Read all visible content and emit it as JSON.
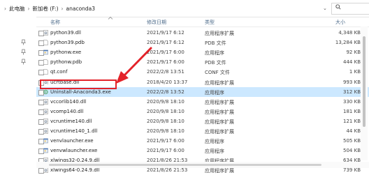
{
  "breadcrumb": {
    "items": [
      "此电脑",
      "新加卷 (F:)",
      "anaconda3"
    ],
    "separator": "›"
  },
  "columns": {
    "name": "名称",
    "modified": "修改日期",
    "type": "类型",
    "size": "大小"
  },
  "files": [
    {
      "name": "python39.dll",
      "modified": "2021/9/17 6:12",
      "type": "应用程序扩展",
      "size": "4,348 KB",
      "icon": "dll-icon"
    },
    {
      "name": "python39.pdb",
      "modified": "2021/9/17 6:12",
      "type": "PDB 文件",
      "size": "13,284 KB",
      "icon": "file-icon"
    },
    {
      "name": "pythonw.exe",
      "modified": "2021/9/17 6:00",
      "type": "应用程序",
      "size": "92 KB",
      "icon": "exe-icon"
    },
    {
      "name": "pythonw.pdb",
      "modified": "2021/9/17 6:00",
      "type": "PDB 文件",
      "size": "444 KB",
      "icon": "file-icon"
    },
    {
      "name": "qt.conf",
      "modified": "2022/2/8 13:51",
      "type": "CONF 文件",
      "size": "1 KB",
      "icon": "file-icon"
    },
    {
      "name": "ucrtbase.dll",
      "modified": "2018/4/20 13:37",
      "type": "应用程序扩展",
      "size": "993 KB",
      "icon": "dll-icon"
    },
    {
      "name": "Uninstall-Anaconda3.exe",
      "modified": "2022/2/8 13:52",
      "type": "应用程序",
      "size": "312 KB",
      "icon": "uninstall-icon"
    },
    {
      "name": "vccorlib140.dll",
      "modified": "2020/9/8 18:10",
      "type": "应用程序扩展",
      "size": "330 KB",
      "icon": "dll-icon"
    },
    {
      "name": "vcomp140.dll",
      "modified": "2020/9/8 18:10",
      "type": "应用程序扩展",
      "size": "181 KB",
      "icon": "dll-icon"
    },
    {
      "name": "vcruntime140.dll",
      "modified": "2020/9/8 18:10",
      "type": "应用程序扩展",
      "size": "121 KB",
      "icon": "dll-icon"
    },
    {
      "name": "vcruntime140_1.dll",
      "modified": "2020/9/8 18:10",
      "type": "应用程序扩展",
      "size": "44 KB",
      "icon": "dll-icon"
    },
    {
      "name": "venvlauncher.exe",
      "modified": "2021/9/17 6:00",
      "type": "应用程序",
      "size": "505 KB",
      "icon": "exe-icon"
    },
    {
      "name": "venvwlauncher.exe",
      "modified": "2021/9/17 6:00",
      "type": "应用程序",
      "size": "504 KB",
      "icon": "exe-icon"
    },
    {
      "name": "xlwings32-0.24.9.dll",
      "modified": "2021/8/26 21:53",
      "type": "应用程序扩展",
      "size": "634 KB",
      "icon": "dll-icon"
    },
    {
      "name": "xlwings64-0.24.9.dll",
      "modified": "2021/8/26 21:53",
      "type": "应用程序扩展",
      "size": "739 KB",
      "icon": "dll-icon"
    }
  ],
  "colors": {
    "selection": "#cce8ff",
    "callout": "#e3232a",
    "header_text": "#4d6b8a"
  }
}
